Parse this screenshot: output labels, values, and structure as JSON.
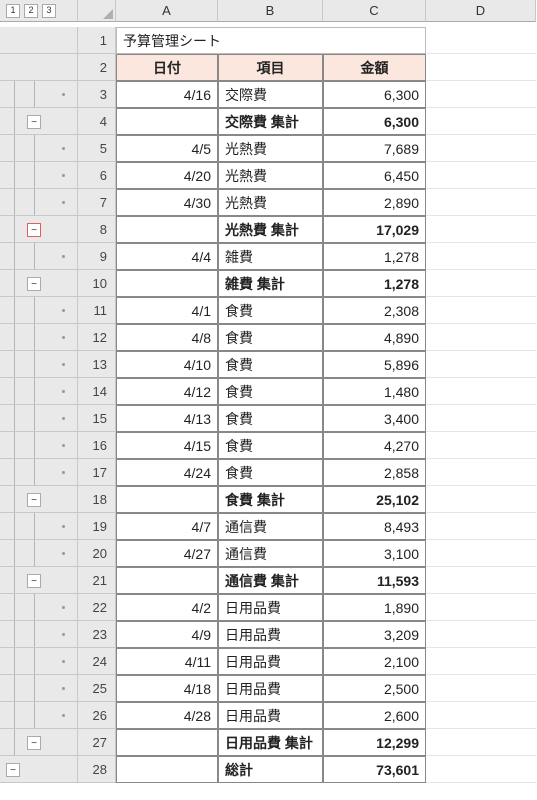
{
  "outline_buttons": [
    "1",
    "2",
    "3"
  ],
  "columns": [
    "A",
    "B",
    "C",
    "D"
  ],
  "title": "予算管理シート",
  "headers": {
    "a": "日付",
    "b": "項目",
    "c": "金額"
  },
  "rows": [
    {
      "n": 3,
      "a": "4/16",
      "b": "交際費",
      "c": "6,300",
      "bold": false,
      "outline": {
        "l1": true,
        "l2": true,
        "dot": true
      }
    },
    {
      "n": 4,
      "a": "",
      "b": "交際費 集計",
      "c": "6,300",
      "bold": true,
      "outline": {
        "l1": true,
        "minus": true
      }
    },
    {
      "n": 5,
      "a": "4/5",
      "b": "光熱費",
      "c": "7,689",
      "bold": false,
      "outline": {
        "l1": true,
        "l2": true,
        "dot": true
      }
    },
    {
      "n": 6,
      "a": "4/20",
      "b": "光熱費",
      "c": "6,450",
      "bold": false,
      "outline": {
        "l1": true,
        "l2": true,
        "dot": true
      }
    },
    {
      "n": 7,
      "a": "4/30",
      "b": "光熱費",
      "c": "2,890",
      "bold": false,
      "outline": {
        "l1": true,
        "l2": true,
        "dot": true
      }
    },
    {
      "n": 8,
      "a": "",
      "b": "光熱費 集計",
      "c": "17,029",
      "bold": true,
      "outline": {
        "l1": true,
        "minus": true,
        "red": true
      }
    },
    {
      "n": 9,
      "a": "4/4",
      "b": "雑費",
      "c": "1,278",
      "bold": false,
      "outline": {
        "l1": true,
        "l2": true,
        "dot": true
      }
    },
    {
      "n": 10,
      "a": "",
      "b": "雑費 集計",
      "c": "1,278",
      "bold": true,
      "outline": {
        "l1": true,
        "minus": true
      }
    },
    {
      "n": 11,
      "a": "4/1",
      "b": "食費",
      "c": "2,308",
      "bold": false,
      "outline": {
        "l1": true,
        "l2": true,
        "dot": true
      }
    },
    {
      "n": 12,
      "a": "4/8",
      "b": "食費",
      "c": "4,890",
      "bold": false,
      "outline": {
        "l1": true,
        "l2": true,
        "dot": true
      }
    },
    {
      "n": 13,
      "a": "4/10",
      "b": "食費",
      "c": "5,896",
      "bold": false,
      "outline": {
        "l1": true,
        "l2": true,
        "dot": true
      }
    },
    {
      "n": 14,
      "a": "4/12",
      "b": "食費",
      "c": "1,480",
      "bold": false,
      "outline": {
        "l1": true,
        "l2": true,
        "dot": true
      }
    },
    {
      "n": 15,
      "a": "4/13",
      "b": "食費",
      "c": "3,400",
      "bold": false,
      "outline": {
        "l1": true,
        "l2": true,
        "dot": true
      }
    },
    {
      "n": 16,
      "a": "4/15",
      "b": "食費",
      "c": "4,270",
      "bold": false,
      "outline": {
        "l1": true,
        "l2": true,
        "dot": true
      }
    },
    {
      "n": 17,
      "a": "4/24",
      "b": "食費",
      "c": "2,858",
      "bold": false,
      "outline": {
        "l1": true,
        "l2": true,
        "dot": true
      }
    },
    {
      "n": 18,
      "a": "",
      "b": "食費 集計",
      "c": "25,102",
      "bold": true,
      "outline": {
        "l1": true,
        "minus": true
      }
    },
    {
      "n": 19,
      "a": "4/7",
      "b": "通信費",
      "c": "8,493",
      "bold": false,
      "outline": {
        "l1": true,
        "l2": true,
        "dot": true
      }
    },
    {
      "n": 20,
      "a": "4/27",
      "b": "通信費",
      "c": "3,100",
      "bold": false,
      "outline": {
        "l1": true,
        "l2": true,
        "dot": true
      }
    },
    {
      "n": 21,
      "a": "",
      "b": "通信費 集計",
      "c": "11,593",
      "bold": true,
      "outline": {
        "l1": true,
        "minus": true
      }
    },
    {
      "n": 22,
      "a": "4/2",
      "b": "日用品費",
      "c": "1,890",
      "bold": false,
      "outline": {
        "l1": true,
        "l2": true,
        "dot": true
      }
    },
    {
      "n": 23,
      "a": "4/9",
      "b": "日用品費",
      "c": "3,209",
      "bold": false,
      "outline": {
        "l1": true,
        "l2": true,
        "dot": true
      }
    },
    {
      "n": 24,
      "a": "4/11",
      "b": "日用品費",
      "c": "2,100",
      "bold": false,
      "outline": {
        "l1": true,
        "l2": true,
        "dot": true
      }
    },
    {
      "n": 25,
      "a": "4/18",
      "b": "日用品費",
      "c": "2,500",
      "bold": false,
      "outline": {
        "l1": true,
        "l2": true,
        "dot": true
      }
    },
    {
      "n": 26,
      "a": "4/28",
      "b": "日用品費",
      "c": "2,600",
      "bold": false,
      "outline": {
        "l1": true,
        "l2": true,
        "dot": true
      }
    },
    {
      "n": 27,
      "a": "",
      "b": "日用品費 集計",
      "c": "12,299",
      "bold": true,
      "outline": {
        "l1": true,
        "minus": true
      }
    },
    {
      "n": 28,
      "a": "",
      "b": "総計",
      "c": "73,601",
      "bold": true,
      "outline": {
        "minus0": true
      }
    }
  ],
  "chart_data": {
    "type": "table",
    "title": "予算管理シート",
    "columns": [
      "日付",
      "項目",
      "金額"
    ],
    "rows": [
      [
        "4/16",
        "交際費",
        6300
      ],
      [
        "",
        "交際費 集計",
        6300
      ],
      [
        "4/5",
        "光熱費",
        7689
      ],
      [
        "4/20",
        "光熱費",
        6450
      ],
      [
        "4/30",
        "光熱費",
        2890
      ],
      [
        "",
        "光熱費 集計",
        17029
      ],
      [
        "4/4",
        "雑費",
        1278
      ],
      [
        "",
        "雑費 集計",
        1278
      ],
      [
        "4/1",
        "食費",
        2308
      ],
      [
        "4/8",
        "食費",
        4890
      ],
      [
        "4/10",
        "食費",
        5896
      ],
      [
        "4/12",
        "食費",
        1480
      ],
      [
        "4/13",
        "食費",
        3400
      ],
      [
        "4/15",
        "食費",
        4270
      ],
      [
        "4/24",
        "食費",
        2858
      ],
      [
        "",
        "食費 集計",
        25102
      ],
      [
        "4/7",
        "通信費",
        8493
      ],
      [
        "4/27",
        "通信費",
        3100
      ],
      [
        "",
        "通信費 集計",
        11593
      ],
      [
        "4/2",
        "日用品費",
        1890
      ],
      [
        "4/9",
        "日用品費",
        3209
      ],
      [
        "4/11",
        "日用品費",
        2100
      ],
      [
        "4/18",
        "日用品費",
        2500
      ],
      [
        "4/28",
        "日用品費",
        2600
      ],
      [
        "",
        "日用品費 集計",
        12299
      ],
      [
        "",
        "総計",
        73601
      ]
    ]
  }
}
